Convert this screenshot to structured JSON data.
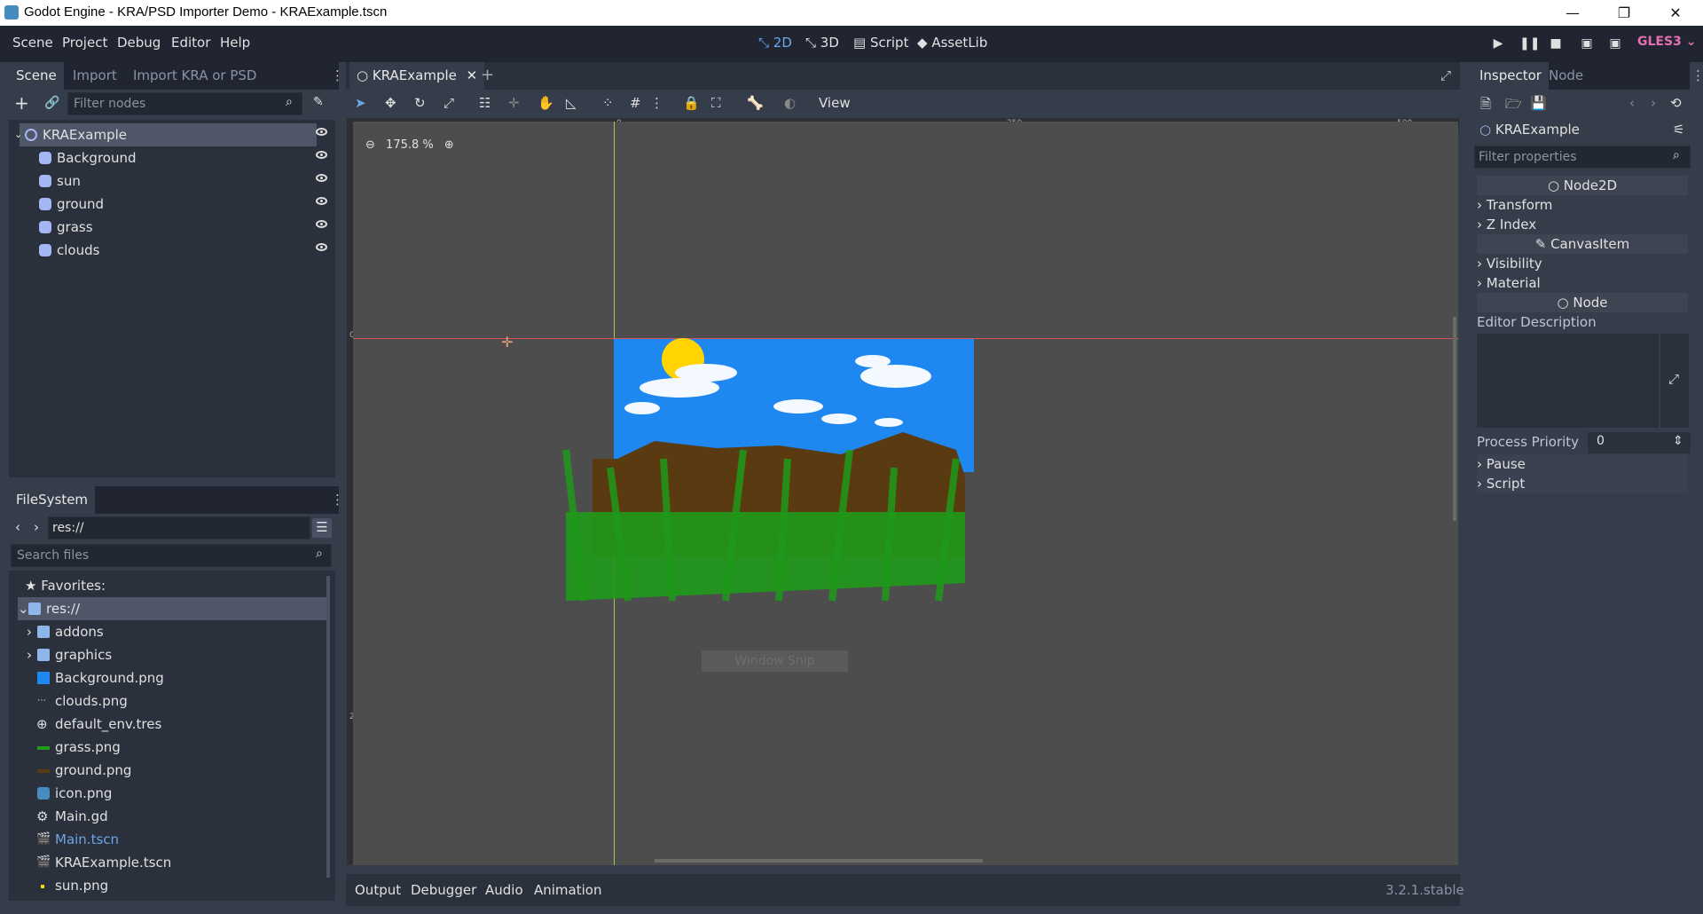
{
  "window": {
    "title": "Godot Engine - KRA/PSD Importer Demo - KRAExample.tscn",
    "minimize": "—",
    "maximize": "❐",
    "close": "✕"
  },
  "menu": {
    "items": [
      "Scene",
      "Project",
      "Debug",
      "Editor",
      "Help"
    ]
  },
  "workspaces": {
    "items": [
      {
        "label": "2D",
        "icon": "2d-icon"
      },
      {
        "label": "3D",
        "icon": "3d-icon"
      },
      {
        "label": "Script",
        "icon": "script-icon"
      },
      {
        "label": "AssetLib",
        "icon": "assetlib-icon"
      }
    ]
  },
  "renderer": "GLES3",
  "scene_dock": {
    "tabs": [
      "Scene",
      "Import",
      "Import KRA or PSD"
    ],
    "filter_placeholder": "Filter nodes",
    "tree": [
      {
        "label": "KRAExample",
        "type": "Node2D",
        "depth": 0,
        "selected": true
      },
      {
        "label": "Background",
        "type": "Sprite",
        "depth": 1
      },
      {
        "label": "sun",
        "type": "Sprite",
        "depth": 1
      },
      {
        "label": "ground",
        "type": "Sprite",
        "depth": 1
      },
      {
        "label": "grass",
        "type": "Sprite",
        "depth": 1
      },
      {
        "label": "clouds",
        "type": "Sprite",
        "depth": 1
      }
    ]
  },
  "filesystem": {
    "tab": "FileSystem",
    "path": "res://",
    "search_placeholder": "Search files",
    "favorites": "Favorites:",
    "items": [
      {
        "label": "res://",
        "icon": "folder-icon",
        "depth": 0,
        "selected": true
      },
      {
        "label": "addons",
        "icon": "folder-icon",
        "depth": 1
      },
      {
        "label": "graphics",
        "icon": "folder-icon",
        "depth": 1
      },
      {
        "label": "Background.png",
        "icon": "image-icon",
        "depth": 1
      },
      {
        "label": "clouds.png",
        "icon": "image-icon",
        "depth": 1
      },
      {
        "label": "default_env.tres",
        "icon": "environment-icon",
        "depth": 1
      },
      {
        "label": "grass.png",
        "icon": "image-icon",
        "depth": 1
      },
      {
        "label": "ground.png",
        "icon": "image-icon",
        "depth": 1
      },
      {
        "label": "icon.png",
        "icon": "image-icon",
        "depth": 1
      },
      {
        "label": "Main.gd",
        "icon": "script-gear-icon",
        "depth": 1
      },
      {
        "label": "Main.tscn",
        "icon": "scene-icon",
        "depth": 1,
        "highlight": true
      },
      {
        "label": "KRAExample.tscn",
        "icon": "scene-icon",
        "depth": 1
      },
      {
        "label": "sun.png",
        "icon": "image-icon",
        "depth": 1
      }
    ]
  },
  "editor": {
    "scene_tab": "KRAExample",
    "view_menu": "View",
    "zoom": "175.8 %",
    "ruler_labels": {
      "h": [
        "0",
        "250",
        "500"
      ],
      "v": [
        "0",
        "250"
      ]
    },
    "overlay_text": "Window Snip"
  },
  "bottom_panel": {
    "tabs": [
      "Output",
      "Debugger",
      "Audio",
      "Animation"
    ],
    "version": "3.2.1.stable"
  },
  "inspector": {
    "tabs": [
      "Inspector",
      "Node"
    ],
    "object": "KRAExample",
    "filter_placeholder": "Filter properties",
    "sections": {
      "node2d": "Node2D",
      "canvasitem": "CanvasItem",
      "node": "Node"
    },
    "groups": {
      "transform": "Transform",
      "zindex": "Z Index",
      "visibility": "Visibility",
      "material": "Material",
      "pause": "Pause",
      "script": "Script"
    },
    "editor_description": "Editor Description",
    "process_priority_label": "Process Priority",
    "process_priority_value": "0"
  },
  "colors": {
    "accent": "#6ea5e6",
    "sky": "#1e88f0",
    "ground": "#5a3a10",
    "grass": "#1f9a1a",
    "sun": "#ffd400",
    "renderer": "#e76fb0"
  }
}
